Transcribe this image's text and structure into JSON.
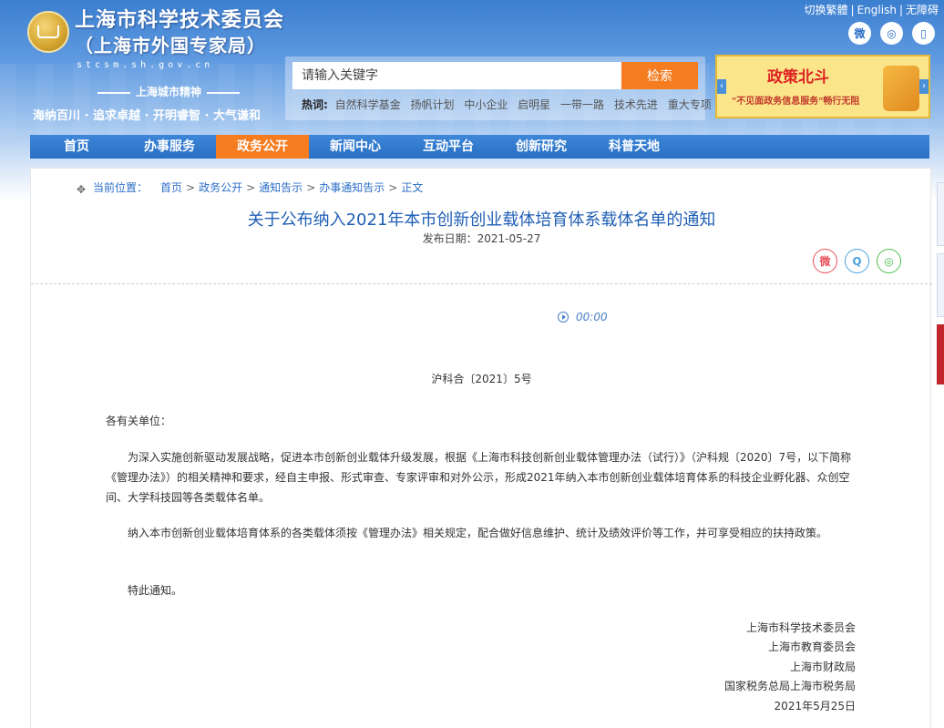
{
  "header": {
    "title": "上海市科学技术委员会",
    "subtitle": "（上海市外国专家局）",
    "domain": "stcsm.sh.gov.cn",
    "spirit_title": "上海城市精神",
    "spirit_text": "海纳百川 · 追求卓越 · 开明睿智 · 大气谦和",
    "top_links": [
      "切换繁體",
      "English",
      "无障碍"
    ],
    "social_icons": [
      "weibo-icon",
      "wechat-icon",
      "mobile-icon"
    ]
  },
  "search": {
    "placeholder": "请输入关键字",
    "button": "检索",
    "hot_label": "热词:",
    "hot_words": [
      "自然科学基金",
      "扬帆计划",
      "中小企业",
      "启明星",
      "一带一路",
      "技术先进",
      "重大专项"
    ]
  },
  "banner": {
    "title": "政策北斗",
    "subtitle": "\"不见面政务信息服务\"畅行无阻"
  },
  "nav": {
    "items": [
      "首页",
      "办事服务",
      "政务公开",
      "新闻中心",
      "互动平台",
      "创新研究",
      "科普天地"
    ],
    "active_index": 2
  },
  "breadcrumb": {
    "label": "当前位置：",
    "items": [
      "首页",
      "政务公开",
      "通知告示",
      "办事通知告示",
      "正文"
    ],
    "separator": ">"
  },
  "article": {
    "title": "关于公布纳入2021年本市创新创业载体培育体系载体名单的通知",
    "date_label": "发布日期：",
    "date": "2021-05-27",
    "audio_time": "00:00",
    "doc_no": "沪科合〔2021〕5号",
    "salutation": "各有关单位：",
    "paragraphs": [
      "为深入实施创新驱动发展战略，促进本市创新创业载体升级发展，根据《上海市科技创新创业载体管理办法（试行）》（沪科规〔2020〕7号，以下简称《管理办法》）的相关精神和要求，经自主申报、形式审查、专家评审和对外公示，形成2021年纳入本市创新创业载体培育体系的科技企业孵化器、众创空间、大学科技园等各类载体名单。",
      "纳入本市创新创业载体培育体系的各类载体须按《管理办法》相关规定，配合做好信息维护、统计及绩效评价等工作，并可享受相应的扶持政策。",
      "特此通知。"
    ],
    "signatures": [
      "上海市科学技术委员会",
      "上海市教育委员会",
      "上海市财政局",
      "国家税务总局上海市税务局",
      "2021年5月25日"
    ]
  }
}
